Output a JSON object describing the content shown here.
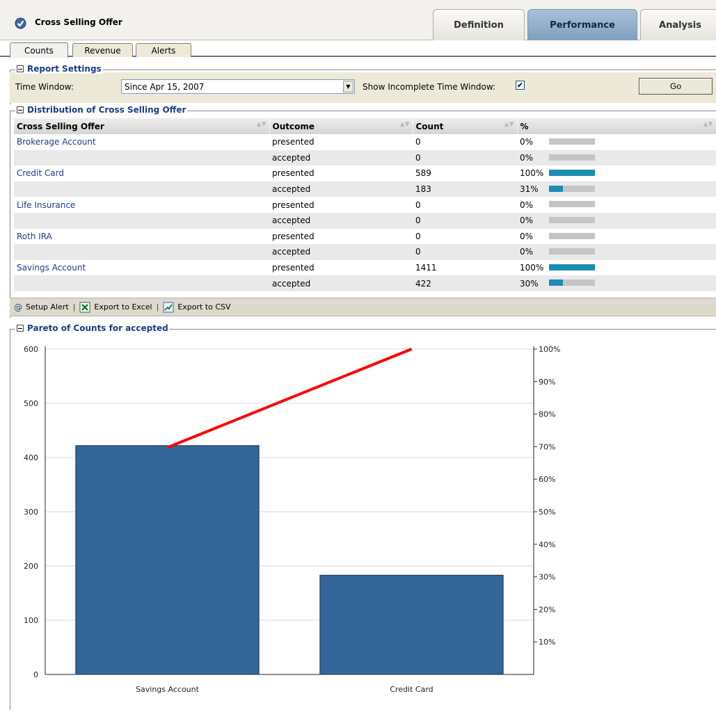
{
  "header": {
    "title": "Cross Selling Offer",
    "tabs": [
      {
        "label": "Definition",
        "active": false
      },
      {
        "label": "Performance",
        "active": true
      },
      {
        "label": "Analysis",
        "active": false
      }
    ]
  },
  "subtabs": [
    {
      "label": "Counts",
      "active": true
    },
    {
      "label": "Revenue",
      "active": false
    },
    {
      "label": "Alerts",
      "active": false
    }
  ],
  "report_settings": {
    "title": "Report Settings",
    "time_window_label": "Time Window:",
    "time_window_value": "Since Apr 15, 2007",
    "incomplete_label": "Show Incomplete Time Window:",
    "incomplete_checked": true,
    "go_label": "Go"
  },
  "distribution": {
    "title": "Distribution of Cross Selling Offer",
    "columns": [
      "Cross Selling Offer",
      "Outcome",
      "Count",
      "%"
    ],
    "rows": [
      {
        "offer": "Brokerage Account",
        "outcome": "presented",
        "count": "0",
        "pct": "0%",
        "pct_value": 0
      },
      {
        "offer": "",
        "outcome": "accepted",
        "count": "0",
        "pct": "0%",
        "pct_value": 0
      },
      {
        "offer": "Credit Card",
        "outcome": "presented",
        "count": "589",
        "pct": "100%",
        "pct_value": 100
      },
      {
        "offer": "",
        "outcome": "accepted",
        "count": "183",
        "pct": "31%",
        "pct_value": 31
      },
      {
        "offer": "Life Insurance",
        "outcome": "presented",
        "count": "0",
        "pct": "0%",
        "pct_value": 0
      },
      {
        "offer": "",
        "outcome": "accepted",
        "count": "0",
        "pct": "0%",
        "pct_value": 0
      },
      {
        "offer": "Roth IRA",
        "outcome": "presented",
        "count": "0",
        "pct": "0%",
        "pct_value": 0
      },
      {
        "offer": "",
        "outcome": "accepted",
        "count": "0",
        "pct": "0%",
        "pct_value": 0
      },
      {
        "offer": "Savings Account",
        "outcome": "presented",
        "count": "1411",
        "pct": "100%",
        "pct_value": 100
      },
      {
        "offer": "",
        "outcome": "accepted",
        "count": "422",
        "pct": "30%",
        "pct_value": 30
      }
    ]
  },
  "toolbar": {
    "setup_alert": "Setup Alert",
    "export_excel": "Export to Excel",
    "export_csv": "Export to CSV",
    "separator": "|"
  },
  "pareto": {
    "title": "Pareto of Counts for accepted"
  },
  "colors": {
    "bar": "#336699",
    "line": "#ff0000",
    "pct_bar": "#1b8db0",
    "legend_text": "#1b3d85"
  },
  "chart_data": {
    "type": "bar",
    "categories": [
      "Savings Account",
      "Credit Card"
    ],
    "values": [
      422,
      183
    ],
    "cumulative_pct": [
      69.75,
      100
    ],
    "ylim": [
      0,
      600
    ],
    "y_ticks": [
      0,
      100,
      200,
      300,
      400,
      500,
      600
    ],
    "y2lim": [
      0,
      100
    ],
    "y2_ticks": [
      "10%",
      "20%",
      "30%",
      "40%",
      "50%",
      "60%",
      "70%",
      "80%",
      "90%",
      "100%"
    ],
    "grid": true,
    "xlabel": "",
    "ylabel": ""
  }
}
